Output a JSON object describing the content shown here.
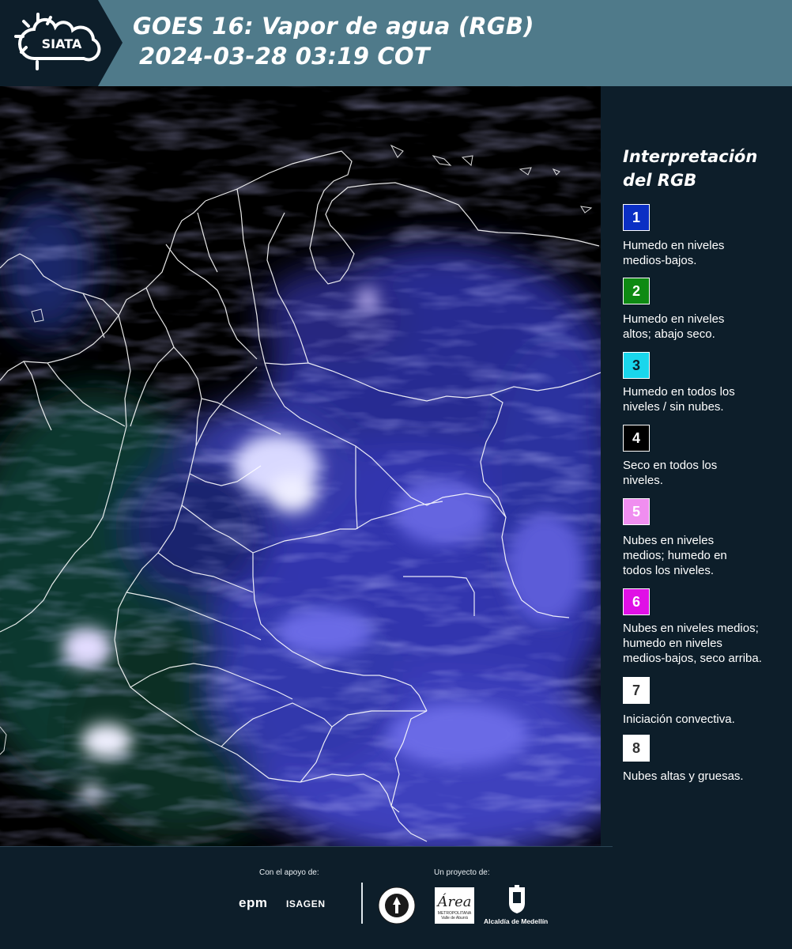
{
  "header": {
    "logo_text": "SIATA",
    "title_line1": "GOES 16: Vapor de agua (RGB)",
    "title_line2": "2024-03-28 03:19 COT",
    "background_color": "#4f7a8a",
    "logo_background_color": "#0d1e2a"
  },
  "map": {
    "icon": "satellite-water-vapor-rgb-image",
    "region": "Colombia"
  },
  "legend": {
    "title_line1": "Interpretación",
    "title_line2": "del RGB",
    "items": [
      {
        "number": "1",
        "color": "#0b2fc4",
        "number_color": "#ffffff",
        "lines": [
          "Humedo en niveles",
          "medios-bajos."
        ]
      },
      {
        "number": "2",
        "color": "#0e8a13",
        "number_color": "#ffffff",
        "lines": [
          "Humedo en niveles",
          "altos; abajo seco."
        ]
      },
      {
        "number": "3",
        "color": "#19d6ec",
        "number_color": "#0d1e2a",
        "lines": [
          "Humedo en todos los",
          "niveles / sin nubes."
        ]
      },
      {
        "number": "4",
        "color": "#000000",
        "number_color": "#ffffff",
        "lines": [
          "Seco en todos los",
          "niveles."
        ]
      },
      {
        "number": "5",
        "color": "#f08ef0",
        "number_color": "#ffffff",
        "lines": [
          "Nubes en niveles",
          "medios; humedo en",
          "todos los niveles."
        ]
      },
      {
        "number": "6",
        "color": "#e010e6",
        "number_color": "#ffffff",
        "lines": [
          "Nubes en niveles medios;",
          "humedo en niveles",
          "medios-bajos, seco arriba."
        ]
      },
      {
        "number": "7",
        "color": "#ffffff",
        "number_color": "#333333",
        "lines": [
          "Iniciación convectiva."
        ]
      },
      {
        "number": "8",
        "color": "#ffffff",
        "number_color": "#333333",
        "lines": [
          "Nubes altas y gruesas."
        ]
      }
    ]
  },
  "footer": {
    "support_label": "Con el apoyo de:",
    "project_label": "Un proyecto de:",
    "sponsors": [
      "epm",
      "ISAGEN"
    ],
    "partners": [
      "Área Metropolitana Valle de Aburrá",
      "Alcaldía de Medellín"
    ],
    "amva_logo_text": "Área",
    "amva_caption": "METROPOLITANA",
    "amva_subcaption": "Valle de Aburrá",
    "alcaldia_text": "Alcaldía de Medellín"
  }
}
